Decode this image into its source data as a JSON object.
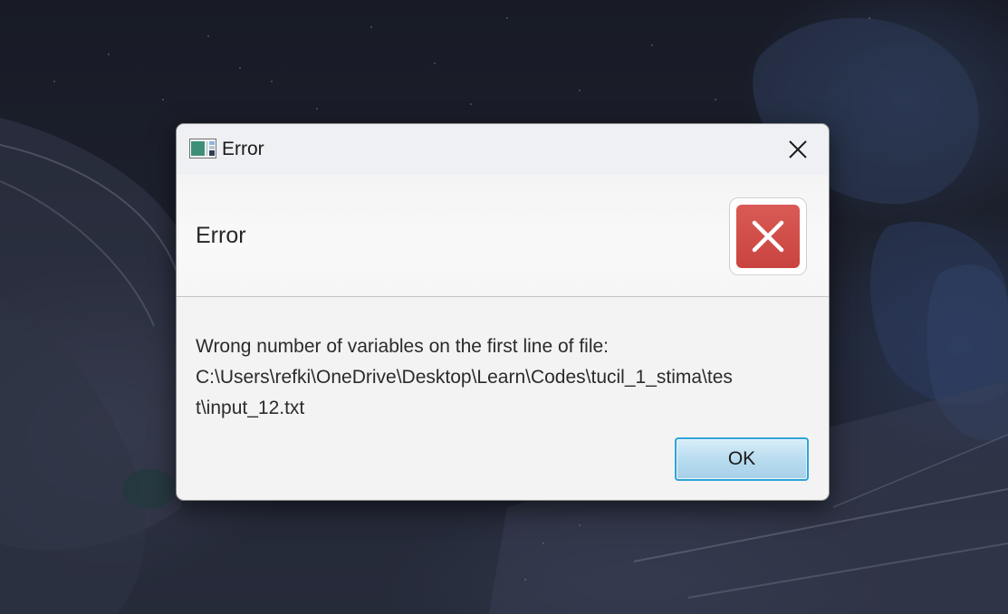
{
  "window": {
    "title": "Error",
    "app_icon": "java-app-icon",
    "close_icon": "close-icon"
  },
  "header": {
    "text": "Error",
    "icon": "error-x-icon",
    "icon_color": "#d0504c"
  },
  "message": {
    "line1": "Wrong number of variables on the first line of file:",
    "line2": "C:\\Users\\refki\\OneDrive\\Desktop\\Learn\\Codes\\tucil_1_stima\\tes",
    "line3": "t\\input_12.txt"
  },
  "buttons": {
    "ok_label": "OK",
    "ok_border_color": "#2ea3d8"
  }
}
